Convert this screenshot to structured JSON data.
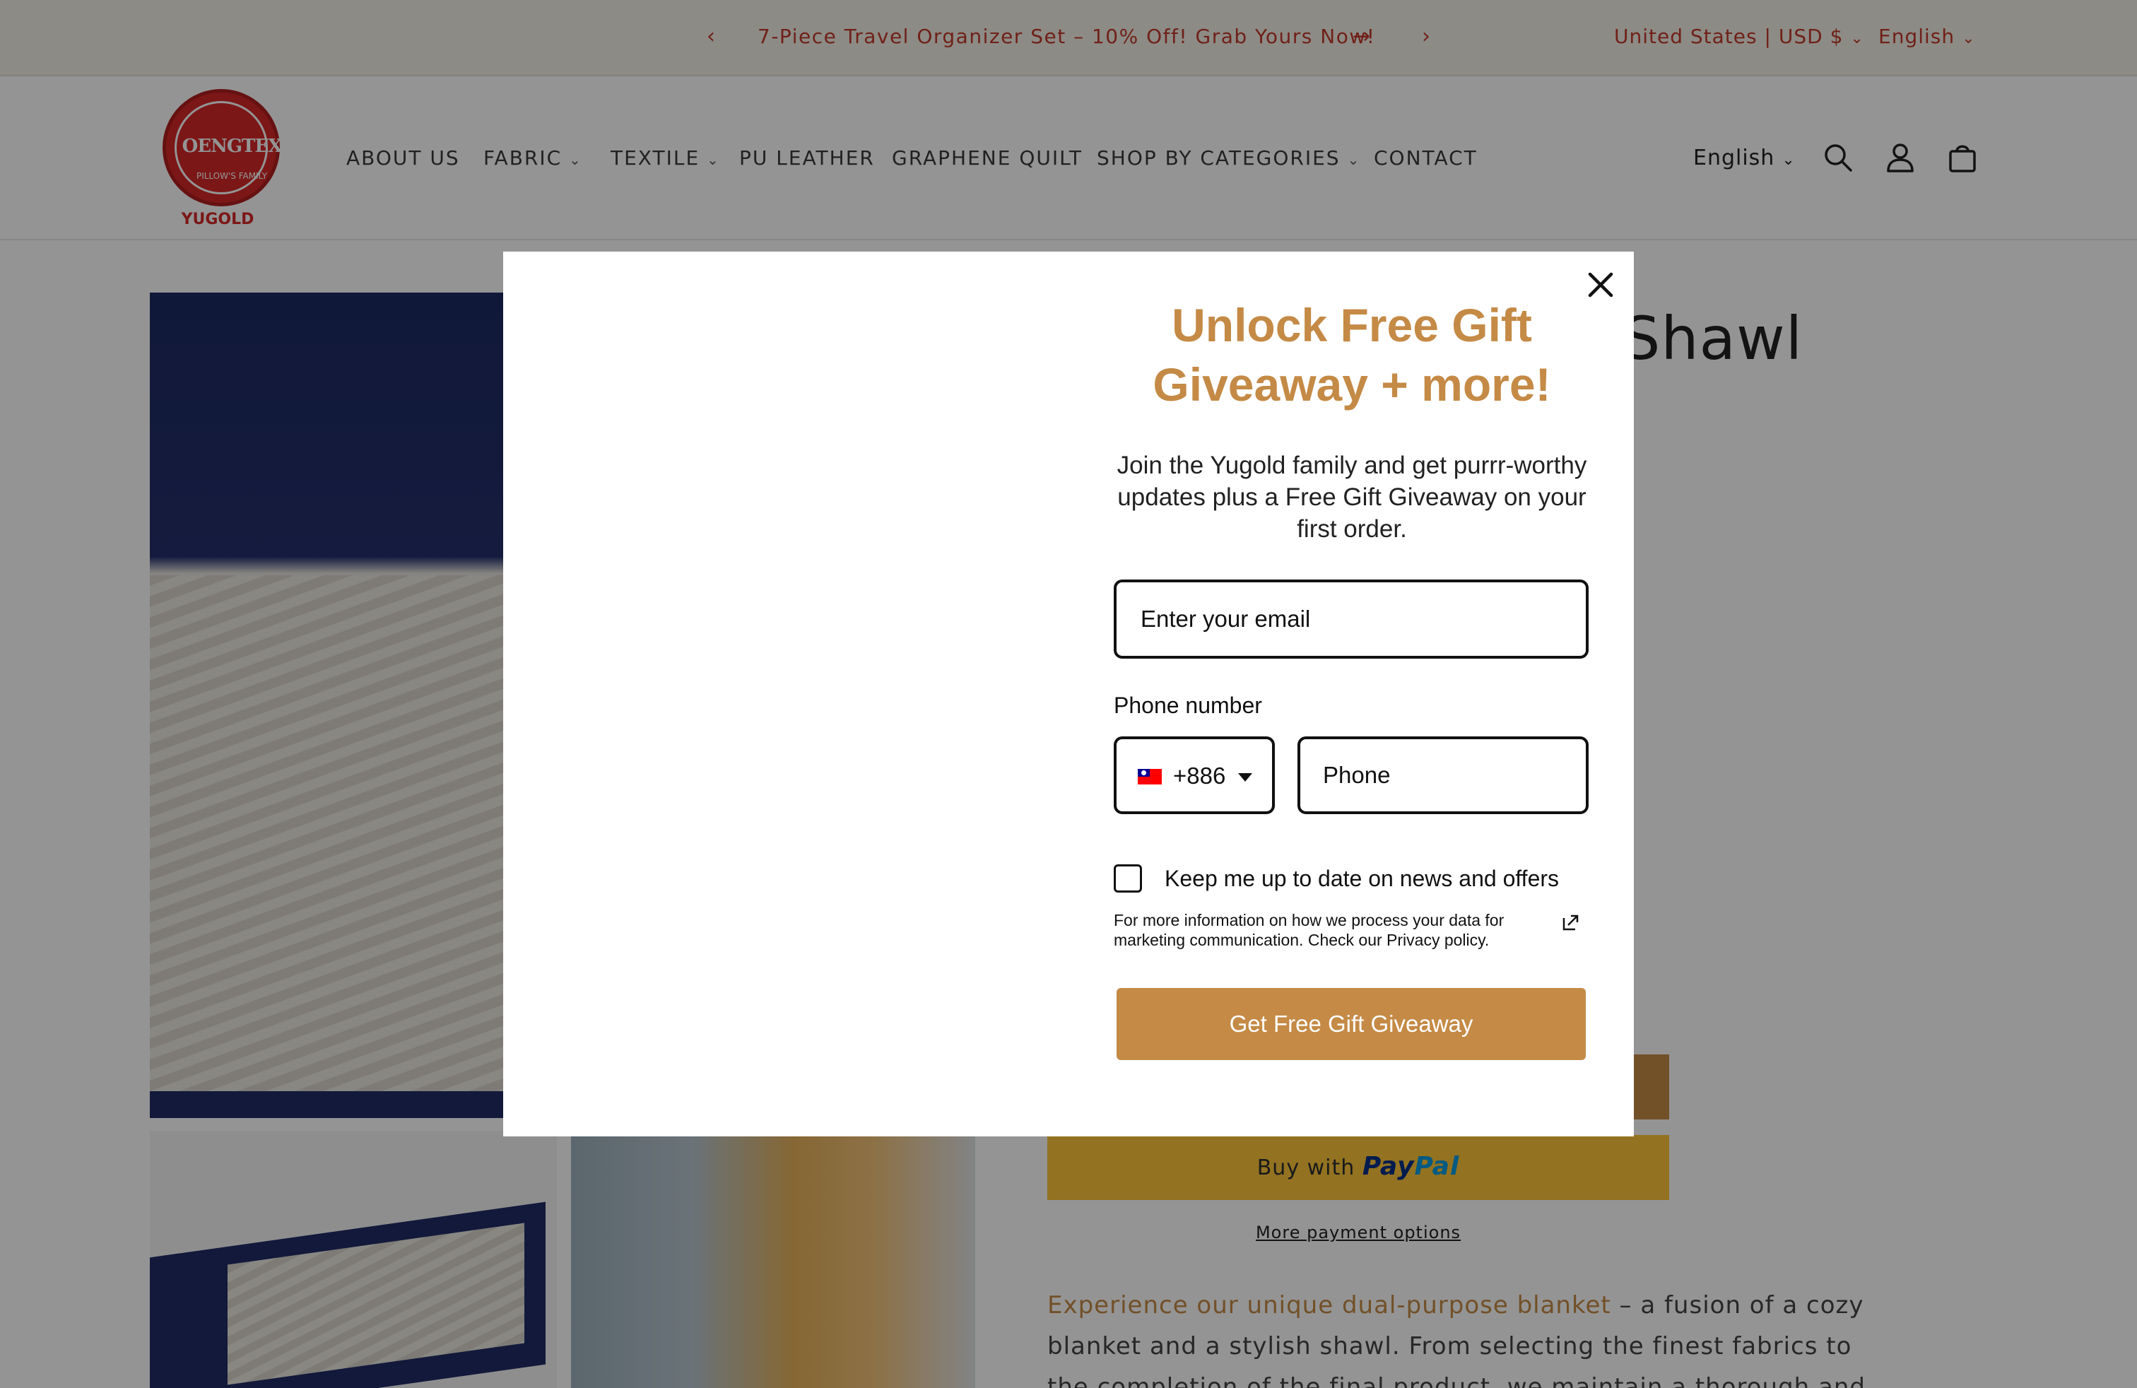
{
  "announcement": {
    "text": "7-Piece Travel Organizer Set – 10% Off! Grab Yours Now!",
    "prev": "‹",
    "next": "›",
    "arrow": "→",
    "country": "United States | USD $",
    "language": "English"
  },
  "header": {
    "logo_mark": "OENGTEX",
    "logo_sub": "PILLOW'S FAMILY",
    "logo_word": "YUGOLD",
    "nav": [
      {
        "label": "ABOUT US"
      },
      {
        "label": "FABRIC"
      },
      {
        "label": "TEXTILE"
      },
      {
        "label": "PU LEATHER"
      },
      {
        "label": "GRAPHENE QUILT"
      },
      {
        "label": "SHOP BY CATEGORIES"
      },
      {
        "label": "CONTACT"
      }
    ],
    "language": "English",
    "chevron": "⌄"
  },
  "product": {
    "title_partial": "Shawl",
    "paypal_prefix": "Buy with",
    "paypal_pay": "Pay",
    "paypal_pal": "Pal",
    "more_payment": "More payment options",
    "desc_highlight": "Experience our unique dual-purpose blanket",
    "desc_rest": " – a fusion of a cozy blanket and a stylish shawl. From selecting the finest fabrics to the completion of the final product, we maintain a thorough and"
  },
  "popup": {
    "title": "Unlock Free Gift Giveaway + more!",
    "subtitle": "Join the Yugold family and get purrr-worthy updates plus a Free Gift Giveaway on your first order.",
    "email_placeholder": "Enter your email",
    "phone_label": "Phone number",
    "country_code": "+886",
    "phone_placeholder": "Phone",
    "checkbox_label": "Keep me up to date on news and offers",
    "privacy_text": "For more information on how we process your data for marketing communication. Check our Privacy policy.",
    "submit_label": "Get Free Gift Giveaway"
  },
  "colors": {
    "accent": "#c48a46",
    "announcement_text": "#c0392b",
    "paypal_yellow": "#fdc439"
  },
  "icons": [
    "search-icon",
    "account-icon",
    "cart-icon",
    "close-icon",
    "external-link-icon",
    "flag-taiwan-icon"
  ]
}
